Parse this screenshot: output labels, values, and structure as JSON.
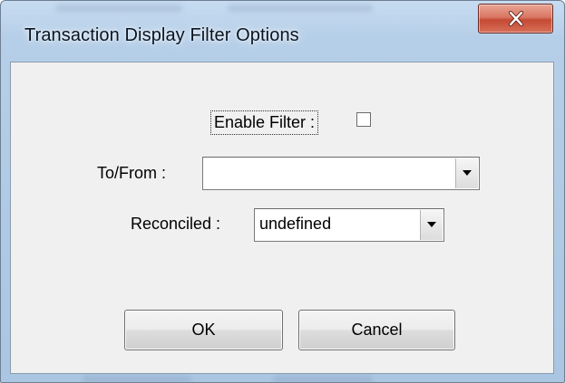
{
  "window": {
    "title": "Transaction Display Filter Options"
  },
  "form": {
    "enable_filter_label": "Enable Filter :",
    "enable_filter_checked": false,
    "to_from_label": "To/From :",
    "to_from_value": "",
    "reconciled_label": "Reconciled :",
    "reconciled_value": "undefined"
  },
  "buttons": {
    "ok_label": "OK",
    "cancel_label": "Cancel"
  },
  "icons": {
    "close": "close-icon",
    "dropdown": "chevron-down-icon"
  },
  "colors": {
    "close_button": "#d97763",
    "client_background": "#f0f0f0",
    "frame": "#b6cfe8"
  }
}
